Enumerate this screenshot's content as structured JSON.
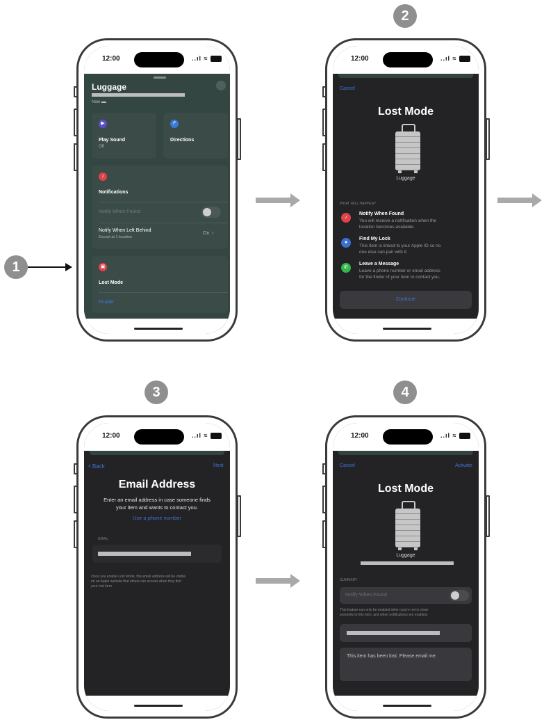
{
  "status": {
    "time": "12:00",
    "signal": "..ıl ≈"
  },
  "steps": [
    "1",
    "2",
    "3",
    "4"
  ],
  "screen1": {
    "title": "Luggage",
    "subtitle": "Now",
    "close": "✕",
    "play_sound": {
      "label": "Play Sound",
      "sub": "Off"
    },
    "directions": {
      "label": "Directions"
    },
    "notifications": {
      "title": "Notifications",
      "notify_found": "Notify When Found",
      "left_behind": "Notify When Left Behind",
      "left_behind_sub": "Except at 1 location",
      "left_behind_value": "On"
    },
    "lost_mode": {
      "title": "Lost Mode",
      "enable": "Enable"
    }
  },
  "screen2": {
    "cancel": "Cancel",
    "title": "Lost Mode",
    "item": "Luggage",
    "section": "WHAT WILL HAPPEN?",
    "items": [
      {
        "title": "Notify When Found",
        "l1": "You will receive a notification when the",
        "l2": "location becomes available."
      },
      {
        "title": "Find My Lock",
        "l1": "This item is linked to your Apple ID so no",
        "l2": "one else can pair with it."
      },
      {
        "title": "Leave a Message",
        "l1": "Leave a phone number or email address",
        "l2": "for the finder of your item to contact you."
      }
    ],
    "continue": "Continue"
  },
  "screen3": {
    "back": "Back",
    "next": "Next",
    "title": "Email Address",
    "desc1": "Enter an email address in case someone finds",
    "desc2": "your item and wants to contact you.",
    "phone_link": "Use a phone number",
    "email_label": "EMAIL",
    "note1": "Once you enable Lost Mode, this email address will be visible",
    "note2": "on an Apple website that others can access when they find",
    "note3": "your lost item."
  },
  "screen4": {
    "cancel": "Cancel",
    "activate": "Activate",
    "title": "Lost Mode",
    "item": "Luggage",
    "summary": "SUMMARY",
    "notify_found": "Notify When Found",
    "note1": "This feature can only be enabled when you're not in close",
    "note2": "proximity to this item, and when notifications are enabled.",
    "message": "This item has been lost. Please email me."
  },
  "icons": {
    "play": "▶",
    "directions": "↱",
    "bell": "♪",
    "lock": "▣",
    "person": "●",
    "phone": "✆",
    "chevron": "›",
    "back_chevron": "‹",
    "battery": "▬"
  },
  "colors": {
    "accent_blue": "#3f74d6",
    "play_icon": "#5a4fc8",
    "directions_icon": "#3a7ad8",
    "alert_red": "#e0424b",
    "person_blue": "#3b6fd1",
    "phone_green": "#33b74a"
  }
}
